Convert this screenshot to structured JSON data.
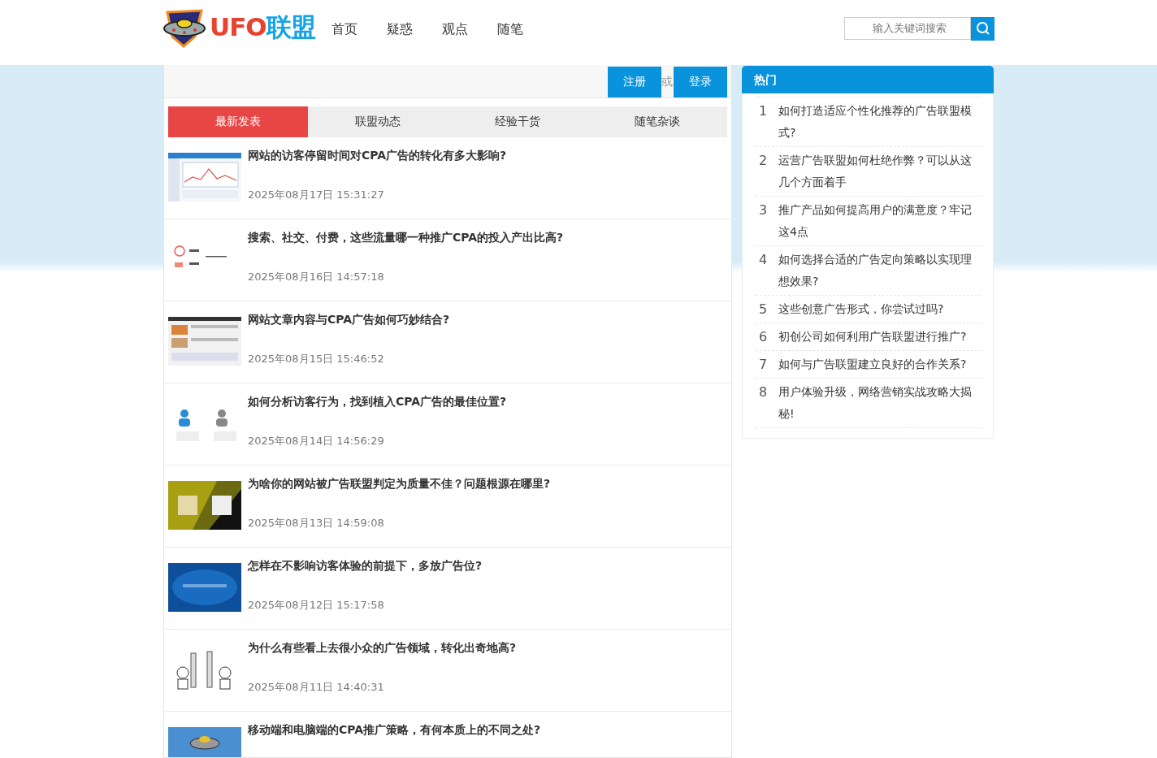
{
  "header": {
    "logo_text": "UFO联盟",
    "nav": [
      "首页",
      "疑惑",
      "观点",
      "随笔"
    ],
    "search": {
      "placeholder": "输入关键词搜索"
    }
  },
  "account": {
    "register": "注册",
    "separator": "或",
    "login": "登录"
  },
  "tabs": [
    {
      "label": "最新发表",
      "selected": true
    },
    {
      "label": "联盟动态",
      "selected": false
    },
    {
      "label": "经验干货",
      "selected": false
    },
    {
      "label": "随笔杂谈",
      "selected": false
    }
  ],
  "articles": [
    {
      "title": "网站的访客停留时间对CPA广告的转化有多大影响?",
      "date": "2025年08月17日 15:31:27"
    },
    {
      "title": "搜索、社交、付费，这些流量哪一种推广CPA的投入产出比高?",
      "date": "2025年08月16日 14:57:18"
    },
    {
      "title": "网站文章内容与CPA广告如何巧妙结合?",
      "date": "2025年08月15日 15:46:52"
    },
    {
      "title": "如何分析访客行为，找到植入CPA广告的最佳位置?",
      "date": "2025年08月14日 14:56:29"
    },
    {
      "title": "为啥你的网站被广告联盟判定为质量不佳？问题根源在哪里?",
      "date": "2025年08月13日 14:59:08"
    },
    {
      "title": "怎样在不影响访客体验的前提下，多放广告位?",
      "date": "2025年08月12日 15:17:58"
    },
    {
      "title": "为什么有些看上去很小众的广告领域，转化出奇地高?",
      "date": "2025年08月11日 14:40:31"
    },
    {
      "title": "移动端和电脑端的CPA推广策略，有何本质上的不同之处?"
    }
  ],
  "hot": {
    "title": "热门",
    "items": [
      {
        "rank": "1",
        "title": "如何打造适应个性化推荐的广告联盟模式?"
      },
      {
        "rank": "2",
        "title": "运营广告联盟如何杜绝作弊？可以从这几个方面着手"
      },
      {
        "rank": "3",
        "title": "推广产品如何提高用户的满意度？牢记这4点"
      },
      {
        "rank": "4",
        "title": "如何选择合适的广告定向策略以实现理想效果?"
      },
      {
        "rank": "5",
        "title": "这些创意广告形式，你尝试过吗?"
      },
      {
        "rank": "6",
        "title": "初创公司如何利用广告联盟进行推广?"
      },
      {
        "rank": "7",
        "title": "如何与广告联盟建立良好的合作关系?"
      },
      {
        "rank": "8",
        "title": "用户体验升级，网络营销实战攻略大揭秘!"
      }
    ]
  }
}
